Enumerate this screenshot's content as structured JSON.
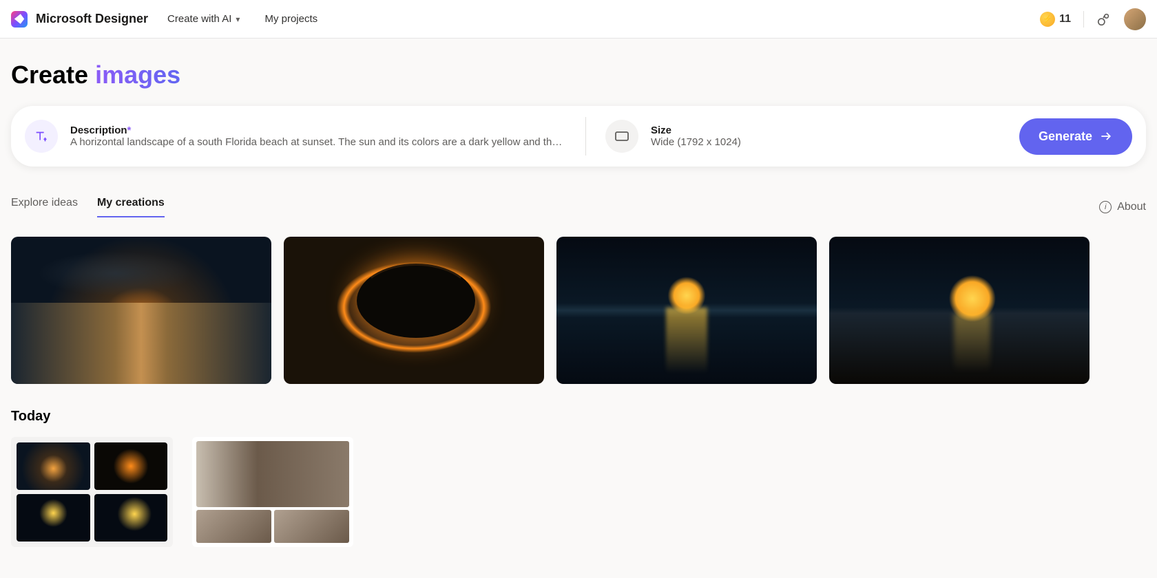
{
  "header": {
    "app_name": "Microsoft Designer",
    "nav": {
      "create_with_ai": "Create with AI",
      "my_projects": "My projects"
    },
    "credits": "11"
  },
  "page_title": {
    "part1": "Create ",
    "part2": "images"
  },
  "prompt": {
    "description_label": "Description",
    "description_value": "A horizontal landscape of a south Florida beach at sunset. The sun and its colors are a dark yellow and the sky surrounding...",
    "size_label": "Size",
    "size_value": "Wide (1792 x 1024)",
    "generate_label": "Generate"
  },
  "tabs": {
    "explore": "Explore ideas",
    "my_creations": "My creations",
    "about": "About"
  },
  "sections": {
    "today": "Today"
  }
}
